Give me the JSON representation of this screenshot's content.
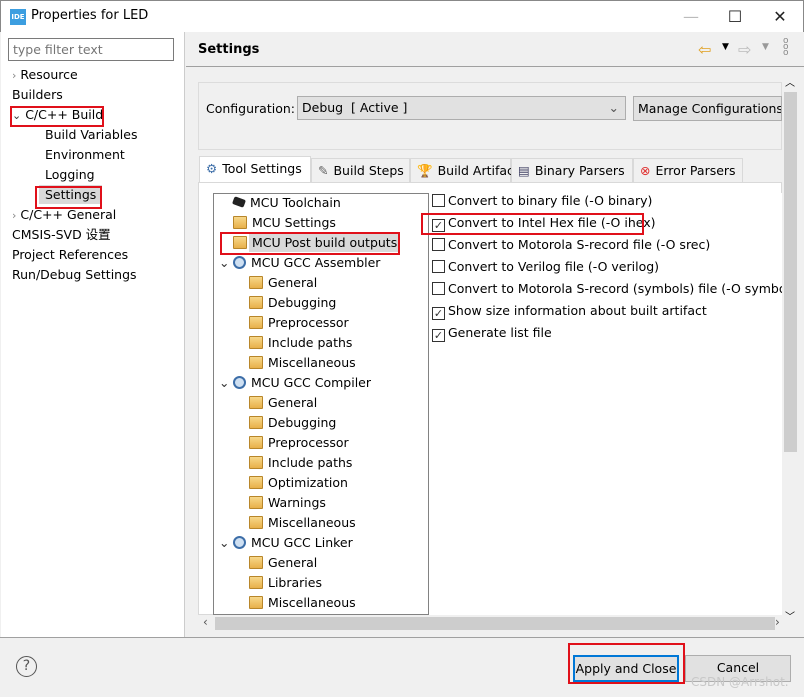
{
  "window": {
    "title": "Properties for LED",
    "app_icon": "IDE",
    "controls": {
      "minimize": "—",
      "maximize": "☐",
      "close": "✕"
    }
  },
  "filter": {
    "placeholder": "type filter text"
  },
  "sidebar": {
    "items": [
      {
        "label": "Resource",
        "expandable": true,
        "expanded": false
      },
      {
        "label": "Builders"
      },
      {
        "label": "C/C++ Build",
        "expandable": true,
        "expanded": true,
        "highlighted": true
      },
      {
        "label": "Build Variables"
      },
      {
        "label": "Environment"
      },
      {
        "label": "Logging"
      },
      {
        "label": "Settings",
        "selected": true,
        "highlighted": true
      },
      {
        "label": "C/C++ General",
        "expandable": true,
        "expanded": false
      },
      {
        "label": "CMSIS-SVD 设置"
      },
      {
        "label": "Project References"
      },
      {
        "label": "Run/Debug Settings"
      }
    ]
  },
  "header": {
    "title": "Settings",
    "icons": [
      "back-arrow-icon",
      "forward-arrow-icon",
      "menu-icon"
    ]
  },
  "configuration": {
    "label": "Configuration:",
    "value": "Debug  [ Active ]",
    "manage_button": "Manage Configurations..."
  },
  "tabs": [
    {
      "label": "Tool Settings",
      "icon": "tool-settings-icon",
      "selected": true
    },
    {
      "label": "Build Steps",
      "icon": "build-steps-icon"
    },
    {
      "label": "Build Artifact",
      "icon": "trophy-icon"
    },
    {
      "label": "Binary Parsers",
      "icon": "binary-file-icon"
    },
    {
      "label": "Error Parsers",
      "icon": "error-icon"
    }
  ],
  "tree": [
    {
      "label": "MCU Toolchain",
      "icon": "chip",
      "level": 0
    },
    {
      "label": "MCU Settings",
      "icon": "folder",
      "level": 0
    },
    {
      "label": "MCU Post build outputs",
      "icon": "folder",
      "level": 0,
      "selected": true,
      "highlighted": true
    },
    {
      "label": "MCU GCC Assembler",
      "icon": "gear",
      "level": 0,
      "expanded": true
    },
    {
      "label": "General",
      "icon": "folder",
      "level": 1
    },
    {
      "label": "Debugging",
      "icon": "folder",
      "level": 1
    },
    {
      "label": "Preprocessor",
      "icon": "folder",
      "level": 1
    },
    {
      "label": "Include paths",
      "icon": "folder",
      "level": 1
    },
    {
      "label": "Miscellaneous",
      "icon": "folder",
      "level": 1
    },
    {
      "label": "MCU GCC Compiler",
      "icon": "gear",
      "level": 0,
      "expanded": true
    },
    {
      "label": "General",
      "icon": "folder",
      "level": 1
    },
    {
      "label": "Debugging",
      "icon": "folder",
      "level": 1
    },
    {
      "label": "Preprocessor",
      "icon": "folder",
      "level": 1
    },
    {
      "label": "Include paths",
      "icon": "folder",
      "level": 1
    },
    {
      "label": "Optimization",
      "icon": "folder",
      "level": 1
    },
    {
      "label": "Warnings",
      "icon": "folder",
      "level": 1
    },
    {
      "label": "Miscellaneous",
      "icon": "folder",
      "level": 1
    },
    {
      "label": "MCU GCC Linker",
      "icon": "gear",
      "level": 0,
      "expanded": true
    },
    {
      "label": "General",
      "icon": "folder",
      "level": 1
    },
    {
      "label": "Libraries",
      "icon": "folder",
      "level": 1
    },
    {
      "label": "Miscellaneous",
      "icon": "folder",
      "level": 1
    }
  ],
  "options": [
    {
      "label": "Convert to binary file (-O binary)",
      "checked": false
    },
    {
      "label": "Convert to Intel Hex file (-O ihex)",
      "checked": true,
      "highlighted": true
    },
    {
      "label": "Convert to Motorola S-record file (-O srec)",
      "checked": false
    },
    {
      "label": "Convert to Verilog file (-O verilog)",
      "checked": false
    },
    {
      "label": "Convert to Motorola S-record (symbols) file (-O symbols",
      "checked": false
    },
    {
      "label": "Show size information about built artifact",
      "checked": true
    },
    {
      "label": "Generate list file",
      "checked": true
    }
  ],
  "footer": {
    "help": "?",
    "apply_close": "Apply and Close",
    "cancel": "Cancel",
    "watermark": "CSDN @Arrshot."
  },
  "colors": {
    "highlight_box": "#e0101a",
    "focus": "#0078d7",
    "selection": "#d9d9d9"
  }
}
